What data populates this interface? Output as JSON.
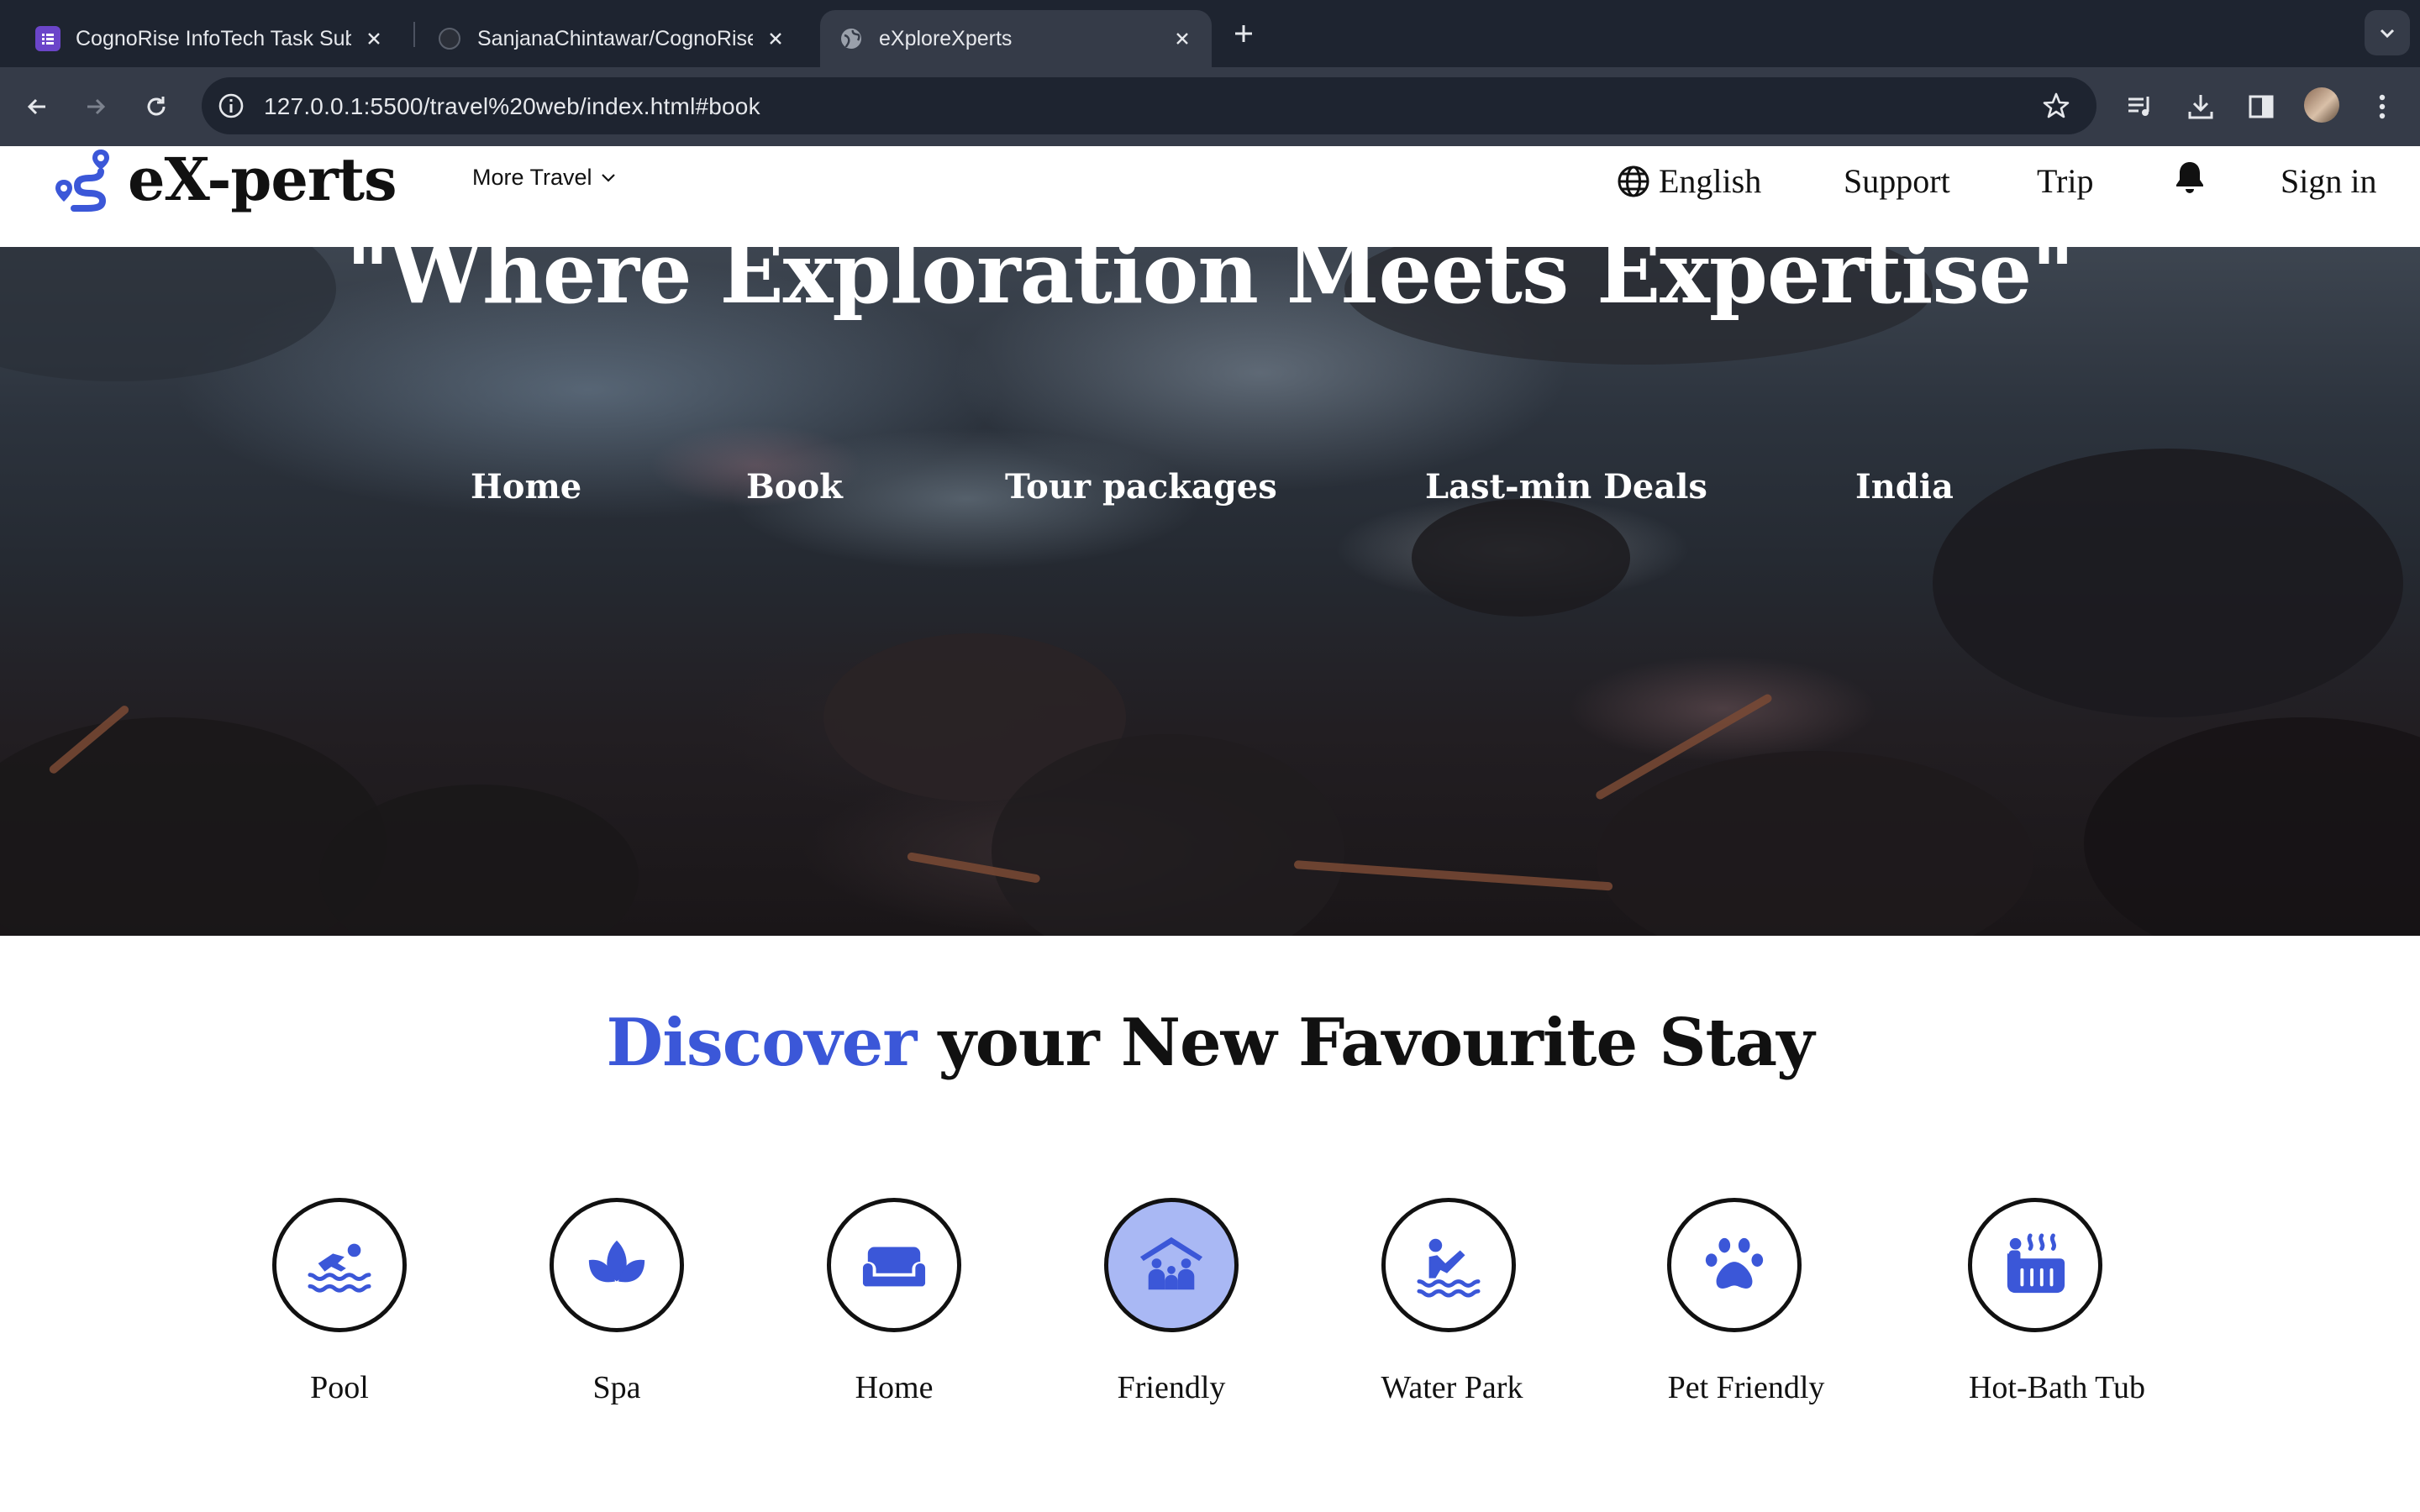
{
  "browser": {
    "tabs": [
      {
        "title": "CognoRise InfoTech Task Submission",
        "favicon": "form-icon"
      },
      {
        "title": "SanjanaChintawar/CognoRise",
        "favicon": "github-icon"
      },
      {
        "title": "eXploreXperts",
        "favicon": "globe-icon"
      }
    ],
    "active_tab": 2,
    "url": "127.0.0.1:5500/travel%20web/index.html#book"
  },
  "header": {
    "logo": "eX-perts",
    "more_travel": "More Travel",
    "language": "English",
    "support": "Support",
    "trip": "Trip",
    "sign_in": "Sign in"
  },
  "hero": {
    "title": "\"Where Exploration Meets Expertise\"",
    "nav": [
      "Home",
      "Book",
      "Tour packages",
      "Last-min Deals",
      "India"
    ]
  },
  "discover": {
    "accent": "Discover",
    "rest": "your New Favourite Stay"
  },
  "amenities": [
    {
      "label": "Pool",
      "icon": "swimmer-icon",
      "selected": false
    },
    {
      "label": "Spa",
      "icon": "spa-lotus-icon",
      "selected": false
    },
    {
      "label": "Home",
      "icon": "couch-icon",
      "selected": false
    },
    {
      "label": "Friendly",
      "icon": "family-house-icon",
      "selected": true
    },
    {
      "label": "Water Park",
      "icon": "water-slide-icon",
      "selected": false
    },
    {
      "label": "Pet Friendly",
      "icon": "paw-icon",
      "selected": false
    },
    {
      "label": "Hot-Bath Tub",
      "icon": "hot-tub-icon",
      "selected": false
    }
  ],
  "colors": {
    "accent": "#3b57d8",
    "selected_bg": "#a9b8f4",
    "chrome_dark": "#1e2430",
    "chrome_mid": "#353b48"
  }
}
